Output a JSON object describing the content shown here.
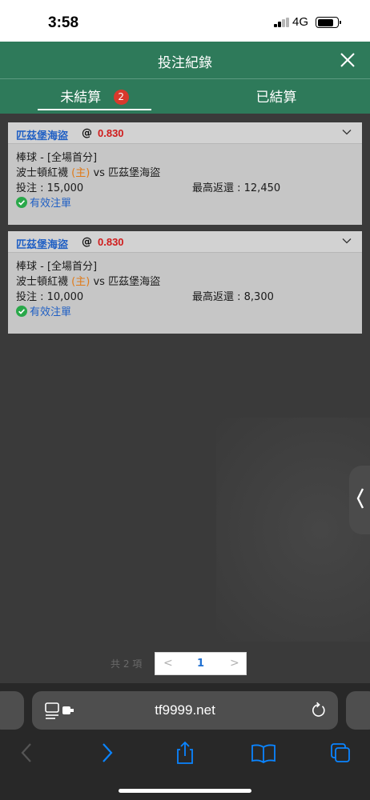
{
  "status_bar": {
    "time": "3:58",
    "network": "4G"
  },
  "header": {
    "title": "投注紀錄"
  },
  "tabs": [
    {
      "label": "未結算",
      "badge": "2",
      "active": true
    },
    {
      "label": "已結算",
      "active": false
    }
  ],
  "bets": [
    {
      "team": "匹茲堡海盜",
      "at": "@",
      "odds": "0.830",
      "market": "棒球 - [全場首分]",
      "home_team": "波士頓紅襪",
      "home_tag": "(主)",
      "vs": "vs",
      "away_team": "匹茲堡海盜",
      "stake": "投注 : 15,000",
      "max_return": "最高返還 : 12,450",
      "status": "有效注單"
    },
    {
      "team": "匹茲堡海盜",
      "at": "@",
      "odds": "0.830",
      "market": "棒球 - [全場首分]",
      "home_team": "波士頓紅襪",
      "home_tag": "(主)",
      "vs": "vs",
      "away_team": "匹茲堡海盜",
      "stake": "投注 : 10,000",
      "max_return": "最高返還 : 8,300",
      "status": "有效注單"
    }
  ],
  "pagination": {
    "total": "共 2 項",
    "prev": "<",
    "current_page": "1",
    "next": ">"
  },
  "browser": {
    "url": "tf9999.net"
  },
  "icons": {
    "close": "close-icon",
    "chevron": "chevron-down-icon",
    "check": "check-circle-icon",
    "reader": "reader-mode-icon",
    "reload": "reload-icon",
    "side_handle": "chevron-left-icon"
  },
  "colors": {
    "header_green": "#2e7a5a",
    "badge_red": "#d8392c",
    "team_blue": "#1f5fc4",
    "odds_red": "#d01c1c",
    "home_orange": "#e07a18",
    "link_blue": "#0a84ff"
  }
}
